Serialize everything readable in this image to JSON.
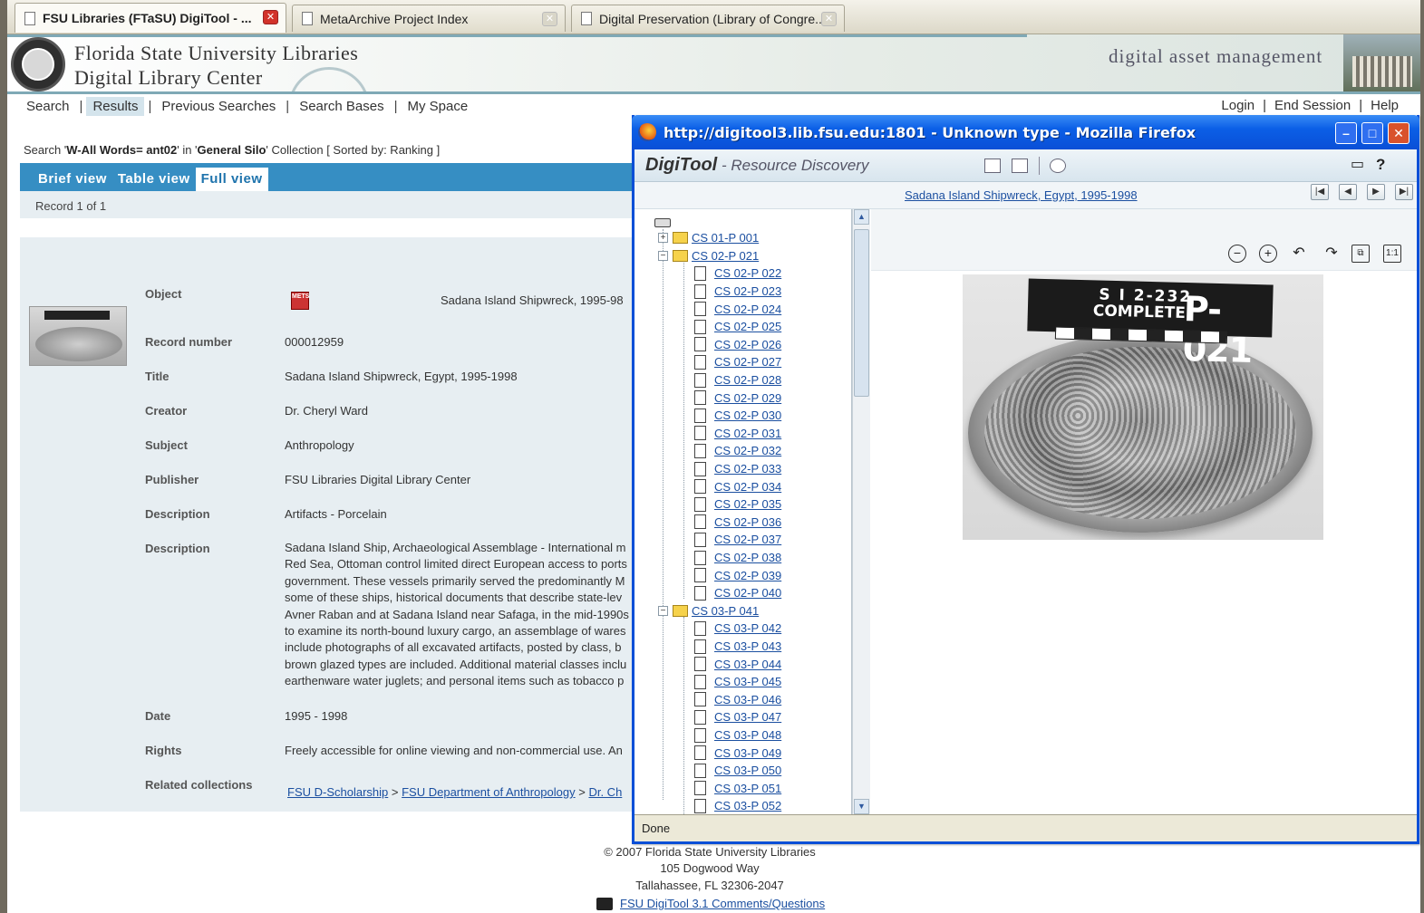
{
  "tabs": [
    {
      "title": "FSU Libraries (FTaSU) DigiTool - ...",
      "active": true
    },
    {
      "title": "MetaArchive Project Index",
      "active": false
    },
    {
      "title": "Digital Preservation (Library of Congre...",
      "active": false
    }
  ],
  "banner": {
    "line1": "Florida State University Libraries",
    "line2": "Digital Library Center",
    "tagline": "digital asset management"
  },
  "nav": {
    "left": [
      "Search",
      "Results",
      "Previous Searches",
      "Search Bases",
      "My Space"
    ],
    "active": "Results",
    "right": [
      "Login",
      "End Session",
      "Help"
    ]
  },
  "search_summary": {
    "prefix": "Search '",
    "query": "W-All Words= ant02",
    "mid": "' in '",
    "collection": "General Silo",
    "suffix": "' Collection [ Sorted by: Ranking ]"
  },
  "views": [
    "Brief view",
    "Table view",
    "Full view"
  ],
  "active_view": "Full view",
  "record_count": "Record 1 of 1",
  "record": {
    "object_label": "Object",
    "object_value": "Sadana Island Shipwreck, 1995-98",
    "mets_icon": "METS",
    "record_number_label": "Record number",
    "record_number": "000012959",
    "title_label": "Title",
    "title": "Sadana Island Shipwreck, Egypt, 1995-1998",
    "creator_label": "Creator",
    "creator": "Dr. Cheryl Ward",
    "subject_label": "Subject",
    "subject": "Anthropology",
    "publisher_label": "Publisher",
    "publisher": "FSU Libraries Digital Library Center",
    "description_label": "Description",
    "description1": "Artifacts - Porcelain",
    "description2_lines": [
      "Sadana Island Ship, Archaeological Assemblage - International m",
      "Red Sea, Ottoman control limited direct European access to ports",
      "government. These vessels primarily served the predominantly M",
      "some of these ships, historical documents that describe state-lev",
      "Avner Raban and at Sadana Island near Safaga, in the mid-1990s",
      "to examine its north-bound luxury cargo, an assemblage of wares",
      "include photographs of all excavated artifacts, posted by class, b",
      "brown glazed types are included. Additional material classes inclu",
      "earthenware water juglets; and personal items such as tobacco p"
    ],
    "date_label": "Date",
    "date": "1995 - 1998",
    "rights_label": "Rights",
    "rights": "Freely accessible for online viewing and non-commercial use. An",
    "related_label": "Related collections",
    "related": [
      "FSU D-Scholarship",
      "FSU Department of Anthropology",
      "Dr. Ch"
    ],
    "related_sep": ">"
  },
  "footer": {
    "copyright": "© 2007 Florida State University Libraries",
    "address1": "105 Dogwood Way",
    "address2": "Tallahassee, FL 32306-2047",
    "link": "FSU DigiTool 3.1 Comments/Questions"
  },
  "popup": {
    "title": "http://digitool3.lib.fsu.edu:1801 - Unknown type - Mozilla Firefox",
    "app_name": "DigiTool",
    "app_sub": " - Resource Discovery",
    "record_title": "Sadana Island Shipwreck, Egypt, 1995-1998",
    "status": "Done",
    "image_label": {
      "line1": "S I 2-232",
      "line2": "COMPLETE",
      "line3": "P-021"
    },
    "tree": [
      {
        "label": "CS 01-P 001",
        "type": "folder",
        "expander": "+"
      },
      {
        "label": "CS 02-P 021",
        "type": "folder",
        "expander": "−"
      },
      {
        "label": "CS 02-P 022",
        "type": "file"
      },
      {
        "label": "CS 02-P 023",
        "type": "file"
      },
      {
        "label": "CS 02-P 024",
        "type": "file"
      },
      {
        "label": "CS 02-P 025",
        "type": "file"
      },
      {
        "label": "CS 02-P 026",
        "type": "file"
      },
      {
        "label": "CS 02-P 027",
        "type": "file"
      },
      {
        "label": "CS 02-P 028",
        "type": "file"
      },
      {
        "label": "CS 02-P 029",
        "type": "file"
      },
      {
        "label": "CS 02-P 030",
        "type": "file"
      },
      {
        "label": "CS 02-P 031",
        "type": "file"
      },
      {
        "label": "CS 02-P 032",
        "type": "file"
      },
      {
        "label": "CS 02-P 033",
        "type": "file"
      },
      {
        "label": "CS 02-P 034",
        "type": "file"
      },
      {
        "label": "CS 02-P 035",
        "type": "file"
      },
      {
        "label": "CS 02-P 036",
        "type": "file"
      },
      {
        "label": "CS 02-P 037",
        "type": "file"
      },
      {
        "label": "CS 02-P 038",
        "type": "file"
      },
      {
        "label": "CS 02-P 039",
        "type": "file"
      },
      {
        "label": "CS 02-P 040",
        "type": "file"
      },
      {
        "label": "CS 03-P 041",
        "type": "folder",
        "expander": "−"
      },
      {
        "label": "CS 03-P 042",
        "type": "file"
      },
      {
        "label": "CS 03-P 043",
        "type": "file"
      },
      {
        "label": "CS 03-P 044",
        "type": "file"
      },
      {
        "label": "CS 03-P 045",
        "type": "file"
      },
      {
        "label": "CS 03-P 046",
        "type": "file"
      },
      {
        "label": "CS 03-P 047",
        "type": "file"
      },
      {
        "label": "CS 03-P 048",
        "type": "file"
      },
      {
        "label": "CS 03-P 049",
        "type": "file"
      },
      {
        "label": "CS 03-P 050",
        "type": "file"
      },
      {
        "label": "CS 03-P 051",
        "type": "file"
      },
      {
        "label": "CS 03-P 052",
        "type": "file"
      }
    ]
  }
}
